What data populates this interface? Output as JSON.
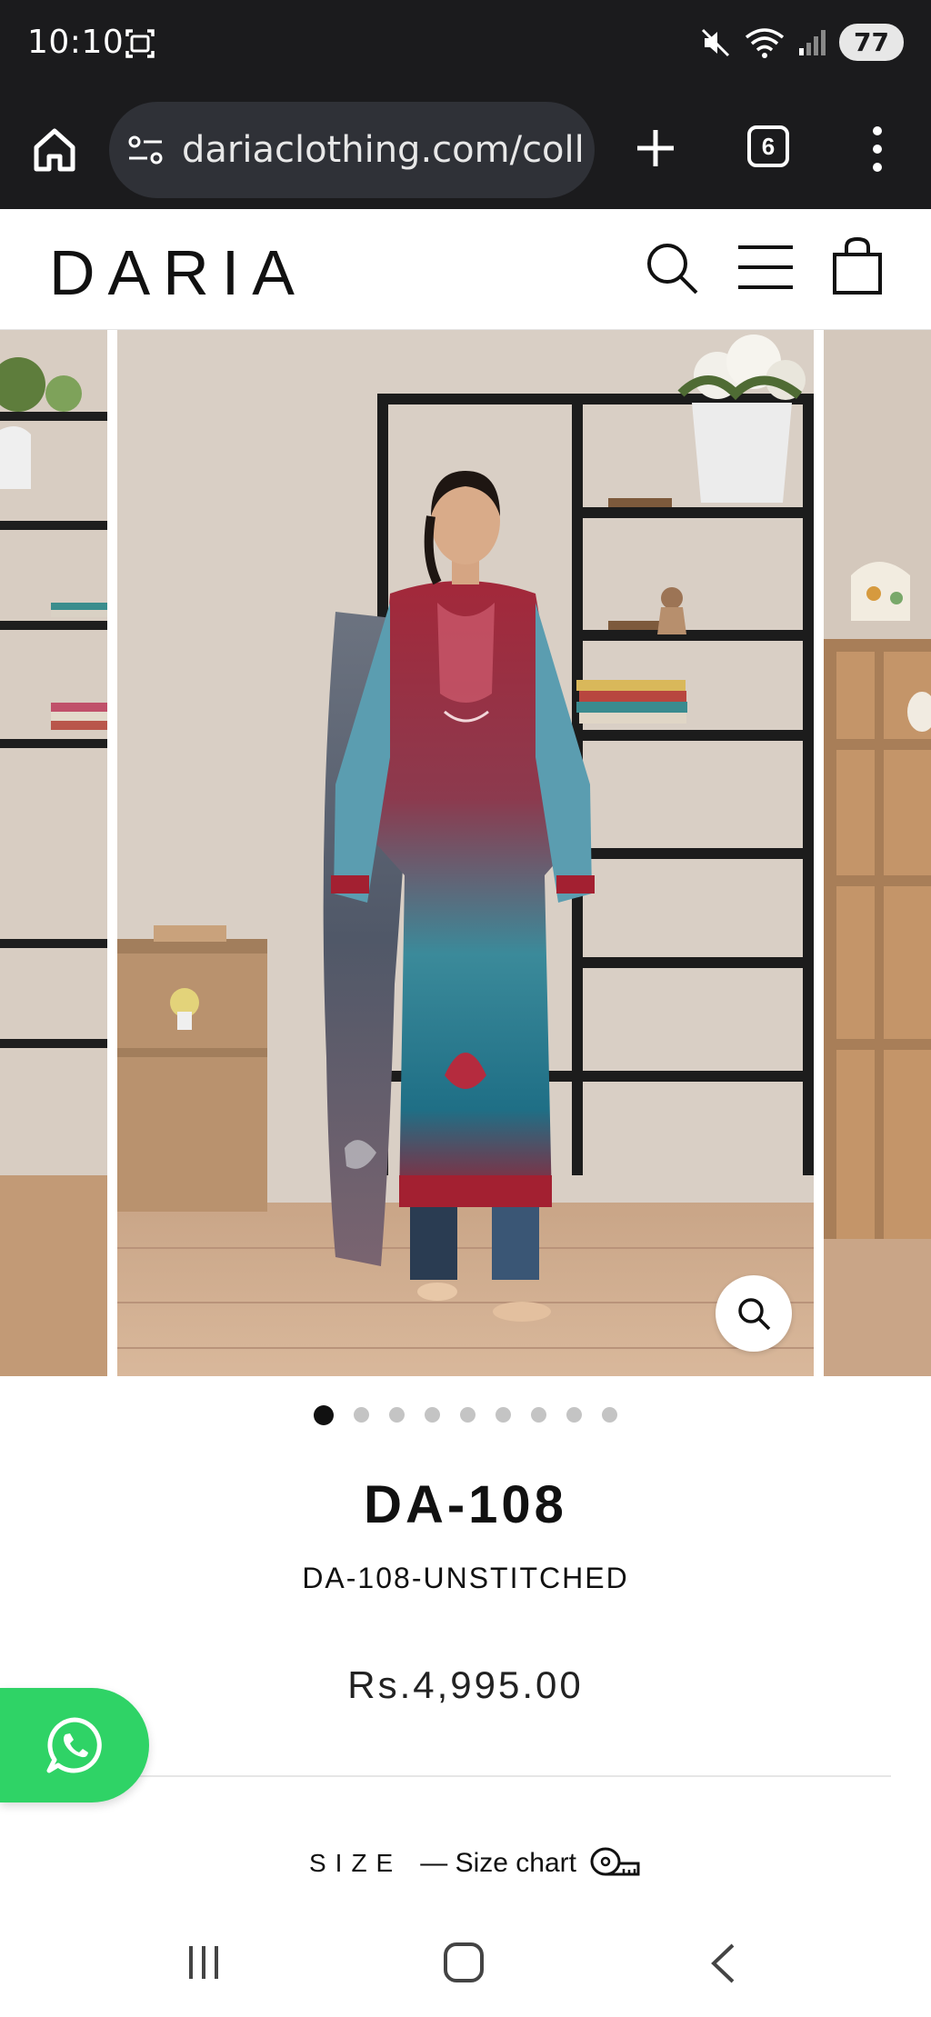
{
  "status_bar": {
    "time": "10:10",
    "battery": "77"
  },
  "browser": {
    "url": "dariaclothing.com/collec",
    "tab_count": "6"
  },
  "store": {
    "logo": "DARIA"
  },
  "gallery": {
    "dots_total": 9,
    "active_index": 0
  },
  "product": {
    "title": "DA-108",
    "sku": "DA-108-UNSTITCHED",
    "price": "Rs.4,995.00"
  },
  "size": {
    "label": "SIZE",
    "chart_link": "— Size chart"
  },
  "colors": {
    "whatsapp": "#2fd366",
    "browser_bg": "#1b1b1d",
    "wall": "#d9cfc5"
  }
}
